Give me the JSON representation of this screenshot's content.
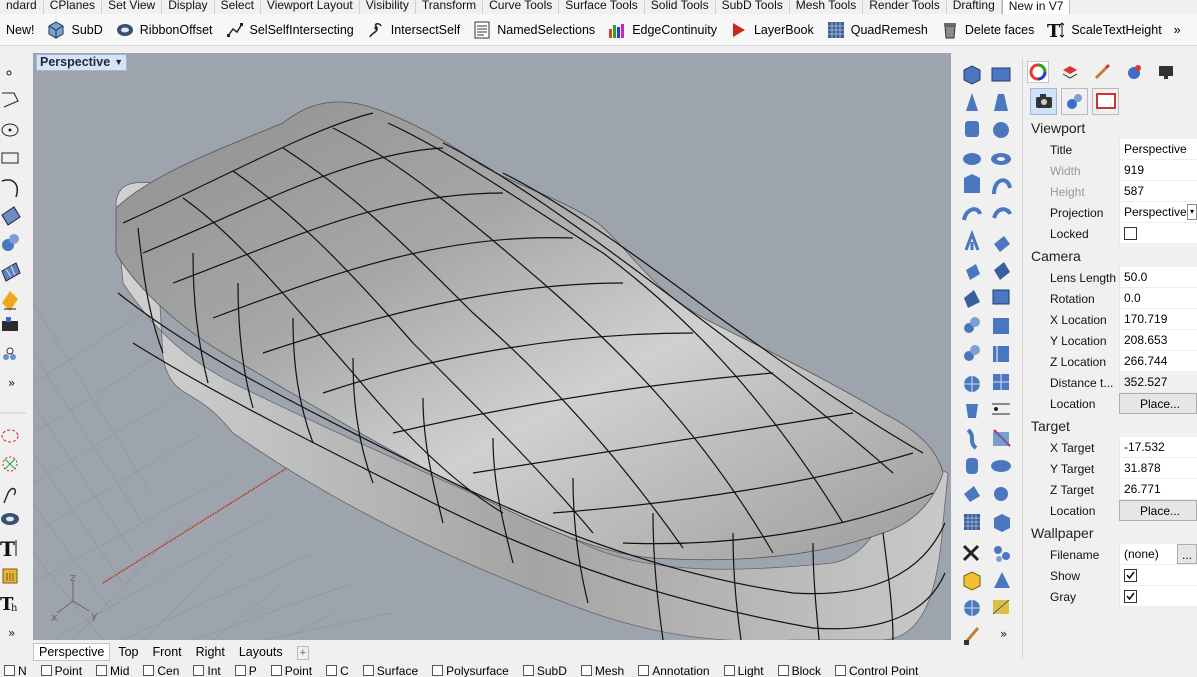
{
  "tabs": [
    "ndard",
    "CPlanes",
    "Set View",
    "Display",
    "Select",
    "Viewport Layout",
    "Visibility",
    "Transform",
    "Curve Tools",
    "Surface Tools",
    "Solid Tools",
    "SubD Tools",
    "Mesh Tools",
    "Render Tools",
    "Drafting",
    "New in V7"
  ],
  "active_tab": "New in V7",
  "ribbon": {
    "new_label": "New!",
    "buttons": [
      "SubD",
      "RibbonOffset",
      "SelSelfIntersecting",
      "IntersectSelf",
      "NamedSelections",
      "EdgeContinuity",
      "LayerBook",
      "QuadRemesh",
      "Delete faces",
      "ScaleTextHeight"
    ],
    "more": "»"
  },
  "viewport": {
    "title": "Perspective",
    "axes": {
      "x": "x",
      "y": "y",
      "z": "z"
    }
  },
  "viewport_tabs": [
    "Perspective",
    "Top",
    "Front",
    "Right",
    "Layouts"
  ],
  "add_tab_icon": "plus",
  "left_more": "»",
  "right_more": "»",
  "panel": {
    "sections": {
      "viewport": "Viewport",
      "camera": "Camera",
      "target": "Target",
      "wallpaper": "Wallpaper"
    },
    "viewport_props": {
      "title_label": "Title",
      "title_value": "Perspective",
      "width_label": "Width",
      "width_value": "919",
      "height_label": "Height",
      "height_value": "587",
      "projection_label": "Projection",
      "projection_value": "Perspective",
      "locked_label": "Locked"
    },
    "camera_props": {
      "lens_label": "Lens Length",
      "lens_value": "50.0",
      "rotation_label": "Rotation",
      "rotation_value": "0.0",
      "xloc_label": "X Location",
      "xloc_value": "170.719",
      "yloc_label": "Y Location",
      "yloc_value": "208.653",
      "zloc_label": "Z Location",
      "zloc_value": "266.744",
      "dist_label": "Distance t...",
      "dist_value": "352.527",
      "location_label": "Location",
      "place_button": "Place..."
    },
    "target_props": {
      "xt_label": "X Target",
      "xt_value": "-17.532",
      "yt_label": "Y Target",
      "yt_value": "31.878",
      "zt_label": "Z Target",
      "zt_value": "26.771",
      "location_label": "Location",
      "place_button": "Place..."
    },
    "wallpaper_props": {
      "filename_label": "Filename",
      "filename_value": "(none)",
      "browse_button": "...",
      "show_label": "Show",
      "show_checked": true,
      "gray_label": "Gray",
      "gray_checked": true
    }
  },
  "colors": {
    "viewport_bg": "#9ea4ad",
    "surface": "#b9b9b9",
    "accent_blue": "#2e6fd0",
    "x_axis": "#c0392b"
  },
  "osnap": [
    "N",
    "Point",
    "Mid",
    "Cen",
    "Int",
    "P",
    "Point",
    "C",
    "Surface",
    "Polysurface",
    "SubD",
    "Mesh",
    "Annotation",
    "Light",
    "Block",
    "Control Point"
  ]
}
